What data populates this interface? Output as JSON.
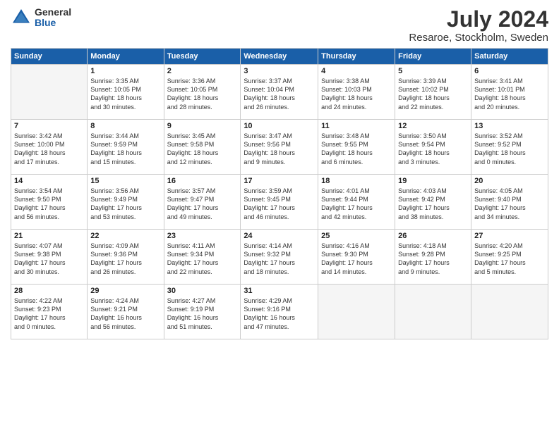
{
  "logo": {
    "general": "General",
    "blue": "Blue"
  },
  "title": "July 2024",
  "location": "Resaroe, Stockholm, Sweden",
  "weekdays": [
    "Sunday",
    "Monday",
    "Tuesday",
    "Wednesday",
    "Thursday",
    "Friday",
    "Saturday"
  ],
  "weeks": [
    [
      {
        "day": "",
        "info": ""
      },
      {
        "day": "1",
        "info": "Sunrise: 3:35 AM\nSunset: 10:05 PM\nDaylight: 18 hours\nand 30 minutes."
      },
      {
        "day": "2",
        "info": "Sunrise: 3:36 AM\nSunset: 10:05 PM\nDaylight: 18 hours\nand 28 minutes."
      },
      {
        "day": "3",
        "info": "Sunrise: 3:37 AM\nSunset: 10:04 PM\nDaylight: 18 hours\nand 26 minutes."
      },
      {
        "day": "4",
        "info": "Sunrise: 3:38 AM\nSunset: 10:03 PM\nDaylight: 18 hours\nand 24 minutes."
      },
      {
        "day": "5",
        "info": "Sunrise: 3:39 AM\nSunset: 10:02 PM\nDaylight: 18 hours\nand 22 minutes."
      },
      {
        "day": "6",
        "info": "Sunrise: 3:41 AM\nSunset: 10:01 PM\nDaylight: 18 hours\nand 20 minutes."
      }
    ],
    [
      {
        "day": "7",
        "info": "Sunrise: 3:42 AM\nSunset: 10:00 PM\nDaylight: 18 hours\nand 17 minutes."
      },
      {
        "day": "8",
        "info": "Sunrise: 3:44 AM\nSunset: 9:59 PM\nDaylight: 18 hours\nand 15 minutes."
      },
      {
        "day": "9",
        "info": "Sunrise: 3:45 AM\nSunset: 9:58 PM\nDaylight: 18 hours\nand 12 minutes."
      },
      {
        "day": "10",
        "info": "Sunrise: 3:47 AM\nSunset: 9:56 PM\nDaylight: 18 hours\nand 9 minutes."
      },
      {
        "day": "11",
        "info": "Sunrise: 3:48 AM\nSunset: 9:55 PM\nDaylight: 18 hours\nand 6 minutes."
      },
      {
        "day": "12",
        "info": "Sunrise: 3:50 AM\nSunset: 9:54 PM\nDaylight: 18 hours\nand 3 minutes."
      },
      {
        "day": "13",
        "info": "Sunrise: 3:52 AM\nSunset: 9:52 PM\nDaylight: 18 hours\nand 0 minutes."
      }
    ],
    [
      {
        "day": "14",
        "info": "Sunrise: 3:54 AM\nSunset: 9:50 PM\nDaylight: 17 hours\nand 56 minutes."
      },
      {
        "day": "15",
        "info": "Sunrise: 3:56 AM\nSunset: 9:49 PM\nDaylight: 17 hours\nand 53 minutes."
      },
      {
        "day": "16",
        "info": "Sunrise: 3:57 AM\nSunset: 9:47 PM\nDaylight: 17 hours\nand 49 minutes."
      },
      {
        "day": "17",
        "info": "Sunrise: 3:59 AM\nSunset: 9:45 PM\nDaylight: 17 hours\nand 46 minutes."
      },
      {
        "day": "18",
        "info": "Sunrise: 4:01 AM\nSunset: 9:44 PM\nDaylight: 17 hours\nand 42 minutes."
      },
      {
        "day": "19",
        "info": "Sunrise: 4:03 AM\nSunset: 9:42 PM\nDaylight: 17 hours\nand 38 minutes."
      },
      {
        "day": "20",
        "info": "Sunrise: 4:05 AM\nSunset: 9:40 PM\nDaylight: 17 hours\nand 34 minutes."
      }
    ],
    [
      {
        "day": "21",
        "info": "Sunrise: 4:07 AM\nSunset: 9:38 PM\nDaylight: 17 hours\nand 30 minutes."
      },
      {
        "day": "22",
        "info": "Sunrise: 4:09 AM\nSunset: 9:36 PM\nDaylight: 17 hours\nand 26 minutes."
      },
      {
        "day": "23",
        "info": "Sunrise: 4:11 AM\nSunset: 9:34 PM\nDaylight: 17 hours\nand 22 minutes."
      },
      {
        "day": "24",
        "info": "Sunrise: 4:14 AM\nSunset: 9:32 PM\nDaylight: 17 hours\nand 18 minutes."
      },
      {
        "day": "25",
        "info": "Sunrise: 4:16 AM\nSunset: 9:30 PM\nDaylight: 17 hours\nand 14 minutes."
      },
      {
        "day": "26",
        "info": "Sunrise: 4:18 AM\nSunset: 9:28 PM\nDaylight: 17 hours\nand 9 minutes."
      },
      {
        "day": "27",
        "info": "Sunrise: 4:20 AM\nSunset: 9:25 PM\nDaylight: 17 hours\nand 5 minutes."
      }
    ],
    [
      {
        "day": "28",
        "info": "Sunrise: 4:22 AM\nSunset: 9:23 PM\nDaylight: 17 hours\nand 0 minutes."
      },
      {
        "day": "29",
        "info": "Sunrise: 4:24 AM\nSunset: 9:21 PM\nDaylight: 16 hours\nand 56 minutes."
      },
      {
        "day": "30",
        "info": "Sunrise: 4:27 AM\nSunset: 9:19 PM\nDaylight: 16 hours\nand 51 minutes."
      },
      {
        "day": "31",
        "info": "Sunrise: 4:29 AM\nSunset: 9:16 PM\nDaylight: 16 hours\nand 47 minutes."
      },
      {
        "day": "",
        "info": ""
      },
      {
        "day": "",
        "info": ""
      },
      {
        "day": "",
        "info": ""
      }
    ]
  ]
}
